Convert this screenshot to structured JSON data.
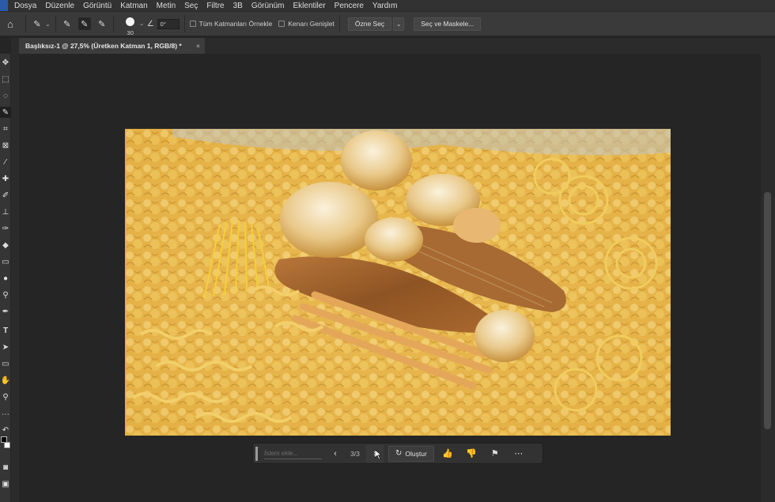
{
  "menubar": {
    "items": [
      "Dosya",
      "Düzenle",
      "Görüntü",
      "Katman",
      "Metin",
      "Seç",
      "Filtre",
      "3B",
      "Görünüm",
      "Eklentiler",
      "Pencere",
      "Yardım"
    ]
  },
  "options": {
    "brush_size": "30",
    "angle": "0°",
    "sample_all_layers": "Tüm Katmanları Örnekle",
    "enhance_edge": "Kenarı Genişlet",
    "select_subject": "Özne Seç",
    "select_and_mask": "Seç ve Maskele..."
  },
  "document": {
    "tab_title": "Başlıksız-1 @ 27,5% (Üretken Katman 1, RGB/8) *",
    "close": "×"
  },
  "generative_bar": {
    "prompt_placeholder": "İstem ekle...",
    "variation_counter": "3/3",
    "generate_label": "Oluştur"
  },
  "colors": {
    "app_bg": "#252525",
    "panel": "#3a3a3a",
    "accent_image": "#e6b84a"
  }
}
